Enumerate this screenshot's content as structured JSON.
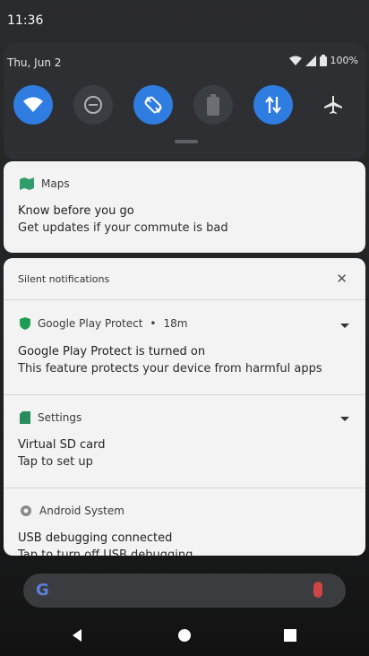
{
  "status_bar": {
    "time": "11:36"
  },
  "quick_settings": {
    "date": "Thu, Jun 2",
    "battery": "100%",
    "tiles": [
      {
        "name": "wifi",
        "state": "on"
      },
      {
        "name": "do-not-disturb",
        "state": "off"
      },
      {
        "name": "auto-rotate",
        "state": "on"
      },
      {
        "name": "battery-saver",
        "state": "off"
      },
      {
        "name": "mobile-data",
        "state": "on"
      },
      {
        "name": "airplane-mode",
        "state": "off"
      }
    ]
  },
  "notifications": {
    "maps": {
      "app": "Maps",
      "title": "Know before you go",
      "text": "Get updates if your commute is bad"
    },
    "silent_header": "Silent notifications",
    "items": [
      {
        "app": "Google Play Protect",
        "time": "18m",
        "title": "Google Play Protect is turned on",
        "text": "This feature protects your device from harmful apps"
      },
      {
        "app": "Settings",
        "title": "Virtual SD card",
        "text": "Tap to set up"
      },
      {
        "app": "Android System",
        "title": "USB debugging connected",
        "text": "Tap to turn off USB debugging"
      }
    ]
  },
  "colors": {
    "accent": "#2f7de1",
    "shade": "#2d2f33",
    "card": "#f3f3f4"
  }
}
